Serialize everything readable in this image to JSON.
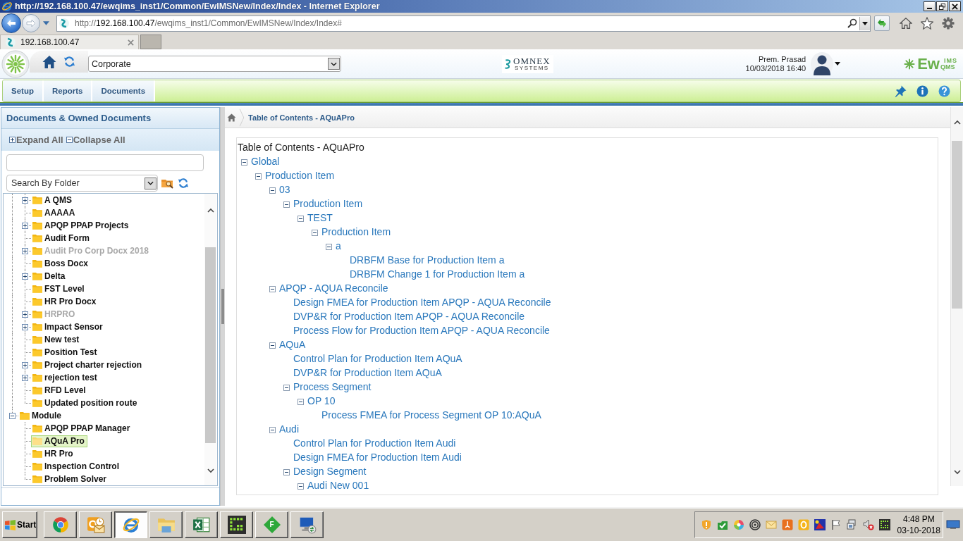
{
  "window": {
    "title": "http://192.168.100.47/ewqims_inst1/Common/EwIMSNew/Index/Index - Internet Explorer"
  },
  "address_bar": {
    "scheme": "http://",
    "host": "192.168.100.47",
    "path": "/ewqims_inst1/Common/EwIMSNew/Index/Index#"
  },
  "browser_tabs": [
    {
      "label": "192.168.100.47",
      "selected": true
    }
  ],
  "app_header": {
    "company_select": {
      "value": "Corporate"
    },
    "vendor_logo": {
      "name": "OMNEX",
      "tagline": "SYSTEMS"
    },
    "user": {
      "name": "Prem. Prasad",
      "datetime": "10/03/2018 16:40"
    },
    "product_logo": {
      "main": "Ew",
      "top": "IMS",
      "bottom": "QMS"
    }
  },
  "nav_tabs": [
    {
      "label": "Setup",
      "selected": false
    },
    {
      "label": "Reports",
      "selected": false
    },
    {
      "label": "Documents",
      "selected": false
    }
  ],
  "left_panel": {
    "title": "Documents & Owned Documents",
    "expand_all": "Expand All",
    "collapse_all": "Collapse All",
    "folder_filter": {
      "value": "Search By Folder"
    },
    "tree": [
      {
        "children": [
          {
            "label": "A QMS",
            "expanded": false,
            "selected": false,
            "disabled": false
          },
          {
            "label": "AAAAA",
            "selected": false,
            "disabled": false
          },
          {
            "label": "APQP PPAP Projects",
            "expanded": false,
            "selected": false,
            "disabled": false
          },
          {
            "label": "Audit Form",
            "selected": false,
            "disabled": false
          },
          {
            "label": "Audit Pro Corp Docx 2018",
            "expanded": false,
            "selected": false,
            "disabled": true
          },
          {
            "label": "Boss Docx",
            "selected": false,
            "disabled": false
          },
          {
            "label": "Delta",
            "expanded": false,
            "selected": false,
            "disabled": false
          },
          {
            "label": "FST Level",
            "selected": false,
            "disabled": false
          },
          {
            "label": "HR Pro Docx",
            "selected": false,
            "disabled": false
          },
          {
            "label": "HRPRO",
            "expanded": false,
            "selected": false,
            "disabled": true
          },
          {
            "label": "Impact Sensor",
            "expanded": false,
            "selected": false,
            "disabled": false
          },
          {
            "label": "New test",
            "selected": false,
            "disabled": false
          },
          {
            "label": "Position Test",
            "selected": false,
            "disabled": false
          },
          {
            "label": "Project charter rejection",
            "expanded": false,
            "selected": false,
            "disabled": false
          },
          {
            "label": "rejection test",
            "expanded": false,
            "selected": false,
            "disabled": false
          },
          {
            "label": "RFD Level",
            "selected": false,
            "disabled": false
          },
          {
            "label": "Updated position route",
            "selected": false,
            "disabled": false
          }
        ]
      },
      {
        "label": "Module",
        "expanded": true,
        "selected": false,
        "disabled": false,
        "children": [
          {
            "label": "APQP PPAP Manager",
            "selected": false,
            "disabled": false
          },
          {
            "label": "AQuA Pro",
            "selected": true,
            "disabled": false
          },
          {
            "label": "HR Pro",
            "selected": false,
            "disabled": false
          },
          {
            "label": "Inspection Control",
            "selected": false,
            "disabled": false
          },
          {
            "label": "Problem Solver",
            "selected": false,
            "disabled": false
          }
        ]
      }
    ]
  },
  "content": {
    "breadcrumb": "Table of Contents - AQuAPro",
    "heading": "Table of Contents - AQuAPro",
    "toc": [
      {
        "label": "Global",
        "expanded": true,
        "children": [
          {
            "label": "Production Item",
            "expanded": true,
            "children": [
              {
                "label": "03",
                "expanded": true,
                "children": [
                  {
                    "label": "Production Item",
                    "expanded": true,
                    "children": [
                      {
                        "label": "TEST",
                        "expanded": true,
                        "children": [
                          {
                            "label": "Production Item",
                            "expanded": true,
                            "children": [
                              {
                                "label": "a",
                                "expanded": true,
                                "children": [
                                  {
                                    "label": "DRBFM Base for Production Item a"
                                  },
                                  {
                                    "label": "DRBFM Change 1 for Production Item a"
                                  }
                                ]
                              }
                            ]
                          }
                        ]
                      }
                    ]
                  }
                ]
              },
              {
                "label": "APQP - AQUA Reconcile",
                "expanded": true,
                "children": [
                  {
                    "label": "Design FMEA for Production Item APQP - AQUA Reconcile"
                  },
                  {
                    "label": "DVP&R for Production Item APQP - AQUA Reconcile"
                  },
                  {
                    "label": "Process Flow for Production Item APQP - AQUA Reconcile"
                  }
                ]
              },
              {
                "label": "AQuA",
                "expanded": true,
                "children": [
                  {
                    "label": "Control Plan for Production Item AQuA"
                  },
                  {
                    "label": "DVP&R for Production Item AQuA"
                  },
                  {
                    "label": "Process Segment",
                    "expanded": true,
                    "children": [
                      {
                        "label": "OP 10",
                        "expanded": true,
                        "children": [
                          {
                            "label": "Process FMEA for Process Segment OP 10:AQuA"
                          }
                        ]
                      }
                    ]
                  }
                ]
              },
              {
                "label": "Audi",
                "expanded": true,
                "children": [
                  {
                    "label": "Control Plan for Production Item Audi"
                  },
                  {
                    "label": "Design FMEA for Production Item Audi"
                  },
                  {
                    "label": "Design Segment",
                    "expanded": true,
                    "children": [
                      {
                        "label": "Audi New 001",
                        "expanded": true
                      }
                    ]
                  }
                ]
              }
            ]
          }
        ]
      }
    ]
  },
  "taskbar": {
    "start": "Start",
    "apps": [
      {
        "selected": false
      },
      {
        "selected": false
      },
      {
        "selected": true
      },
      {
        "selected": false
      },
      {
        "selected": false
      },
      {
        "selected": false
      },
      {
        "selected": false,
        "letter": "F"
      },
      {
        "selected": false
      }
    ],
    "clock": {
      "time": "4:48 PM",
      "date": "03-10-2018"
    }
  }
}
